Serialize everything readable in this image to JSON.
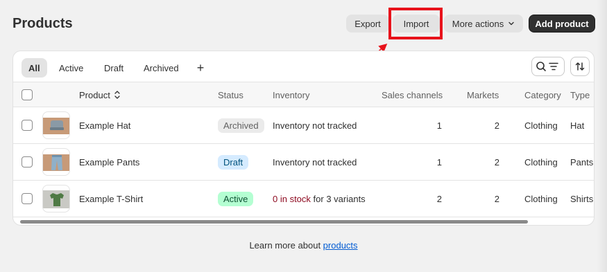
{
  "page": {
    "title": "Products"
  },
  "header_actions": {
    "export": "Export",
    "import": "Import",
    "more_actions": "More actions",
    "add_product": "Add product"
  },
  "tabs": [
    "All",
    "Active",
    "Draft",
    "Archived"
  ],
  "table": {
    "columns": [
      "Product",
      "Status",
      "Inventory",
      "Sales channels",
      "Markets",
      "Category",
      "Type"
    ],
    "rows": [
      {
        "product": "Example Hat",
        "status": "Archived",
        "inventory_a": "Inventory not tracked",
        "inventory_b": "",
        "sales_channels": "1",
        "markets": "2",
        "category": "Clothing",
        "type": "Hat",
        "thumb_icon": "hat-image"
      },
      {
        "product": "Example Pants",
        "status": "Draft",
        "inventory_a": "Inventory not tracked",
        "inventory_b": "",
        "sales_channels": "1",
        "markets": "2",
        "category": "Clothing",
        "type": "Pants",
        "thumb_icon": "pants-image"
      },
      {
        "product": "Example T-Shirt",
        "status": "Active",
        "inventory_a": "0 in stock",
        "inventory_b": " for 3 variants",
        "sales_channels": "2",
        "markets": "2",
        "category": "Clothing",
        "type": "Shirts",
        "thumb_icon": "tshirt-image"
      }
    ]
  },
  "footer": {
    "prefix": "Learn more about ",
    "link": "products"
  },
  "colors": {
    "highlight": "#e8121b",
    "primary": "#303030",
    "link": "#005bd3"
  }
}
